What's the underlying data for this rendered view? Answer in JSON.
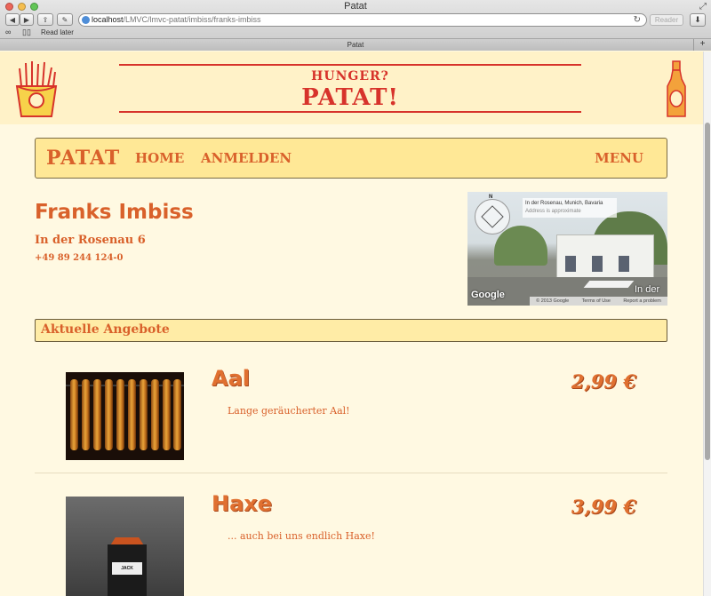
{
  "browser": {
    "window_title": "Patat",
    "url_host": "localhost",
    "url_path": "/LMVC/lmvc-patat/imbiss/franks-imbiss",
    "reader_label": "Reader",
    "bookmark_read_later": "Read later",
    "tab_title": "Patat"
  },
  "header": {
    "tagline": "HUNGER?",
    "title": "PATAT!"
  },
  "nav": {
    "brand": "PATAT",
    "home": "HOME",
    "login": "ANMELDEN",
    "menu": "MENU"
  },
  "restaurant": {
    "name": "Franks Imbiss",
    "address": "In der Rosenau 6",
    "phone": "+49 89 244 124-0"
  },
  "map": {
    "compass": "N",
    "location": "In der Rosenau, Munich, Bavaria",
    "approx": "Address is approximate",
    "brand": "Google",
    "street_label": "In der",
    "copyright": "© 2013 Google",
    "terms": "Terms of Use",
    "report": "Report a problem"
  },
  "offers": {
    "title": "Aktuelle Angebote",
    "items": [
      {
        "name": "Aal",
        "price": "2,99 €",
        "description": "Lange geräucherter Aal!"
      },
      {
        "name": "Haxe",
        "price": "3,99 €",
        "description": "... auch bei uns endlich Haxe!"
      }
    ]
  },
  "colors": {
    "accent_red": "#d7332b",
    "accent_orange": "#d9612b",
    "page_background": "#fff9e2",
    "nav_background": "#ffe896"
  }
}
